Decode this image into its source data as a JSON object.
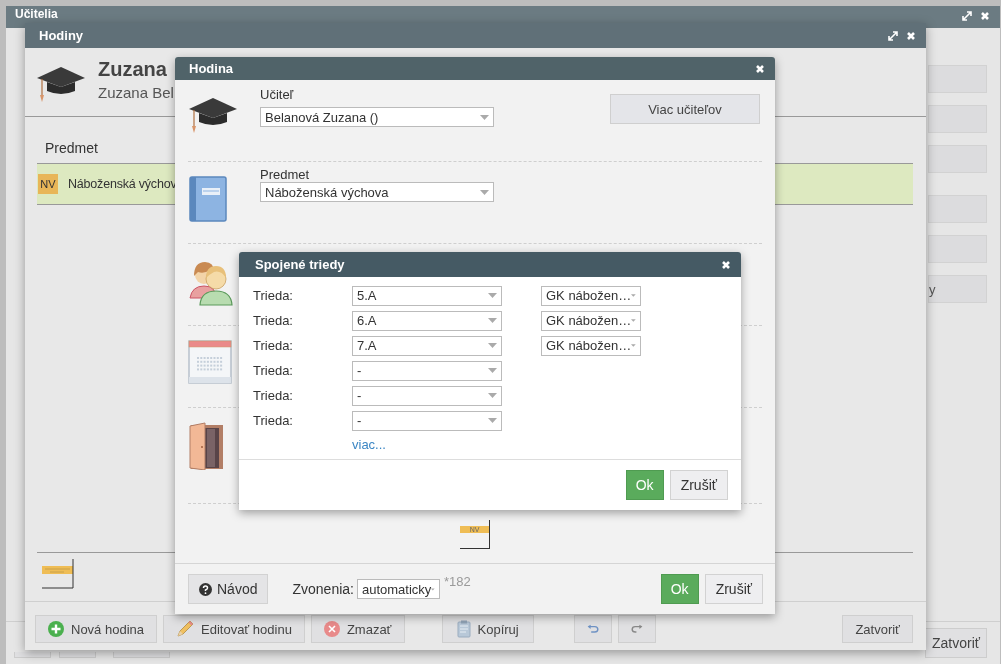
{
  "main_window": {
    "title": "Učitelia",
    "side_buttons": [
      {
        "kind": "blank"
      },
      {
        "kind": "blank"
      },
      {
        "kind": "blank"
      },
      {
        "kind": "blank"
      },
      {
        "kind": "blank"
      },
      {
        "kind": "text",
        "label": "y"
      }
    ],
    "footer_buttons": [
      {
        "kind": "blank"
      },
      {
        "kind": "blank"
      },
      {
        "kind": "blank"
      },
      {
        "kind": "text",
        "label": "Zatvoriť"
      }
    ]
  },
  "lessons_window": {
    "title": "Hodiny",
    "teacher_name": "Zuzana",
    "teacher_full_name": "Zuzana Bel",
    "table": {
      "columns": [
        "Predmet"
      ],
      "rows": [
        {
          "badge": "NV",
          "subject": "Náboženská výchov",
          "selected": true
        }
      ]
    },
    "buttons": [
      {
        "kind": "add",
        "label": "Nová hodina"
      },
      {
        "kind": "edit",
        "label": "Editovať hodinu"
      },
      {
        "kind": "delete",
        "label": "Zmazať"
      },
      {
        "kind": "copy",
        "label": "Kopíruj"
      },
      {
        "kind": "undo"
      },
      {
        "kind": "redo"
      },
      {
        "kind": "close",
        "label": "Zatvoriť"
      }
    ]
  },
  "lesson_dialog": {
    "title": "Hodina",
    "sections": [
      {
        "kind": "teacher",
        "label": "Učiteľ",
        "value": "Belanová Zuzana ()",
        "button": "Viac učiteľov"
      },
      {
        "kind": "subject",
        "label": "Predmet",
        "value": "Náboženská výchova"
      },
      {
        "kind": "classes"
      },
      {
        "kind": "time"
      },
      {
        "kind": "room"
      }
    ],
    "lesson_tile": "NV",
    "help_button": "Návod",
    "bells_label": "Zvonenia:",
    "bells_value": "automaticky",
    "note": "*182",
    "buttons": [
      {
        "kind": "primary",
        "label": "Ok"
      },
      {
        "kind": "default",
        "label": "Zrušiť"
      }
    ]
  },
  "joined_classes_dialog": {
    "title": "Spojené triedy",
    "rows": [
      {
        "label": "Trieda:",
        "class": "5.A",
        "group": "GK nábožen…"
      },
      {
        "label": "Trieda:",
        "class": "6.A",
        "group": "GK nábožen…"
      },
      {
        "label": "Trieda:",
        "class": "7.A",
        "group": "GK nábožen…"
      },
      {
        "label": "Trieda:",
        "class": "-"
      },
      {
        "label": "Trieda:",
        "class": "-"
      },
      {
        "label": "Trieda:",
        "class": "-"
      }
    ],
    "more_link": "viac...",
    "buttons": [
      {
        "kind": "primary",
        "label": "Ok"
      },
      {
        "kind": "default",
        "label": "Zrušiť"
      }
    ]
  }
}
